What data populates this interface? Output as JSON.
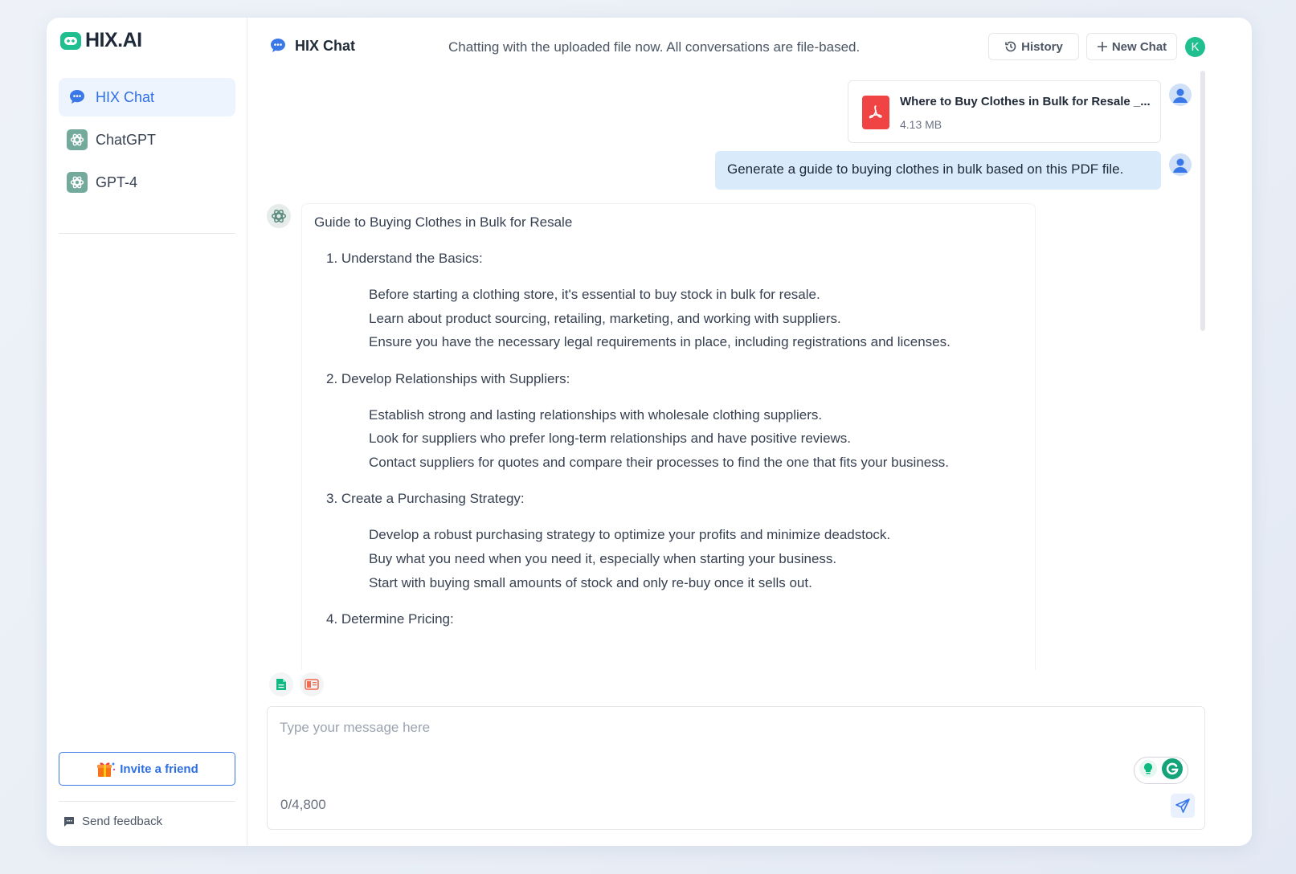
{
  "app": {
    "logo_text": "HIX.AI"
  },
  "sidebar": {
    "items": [
      {
        "label": "HIX Chat",
        "icon": "chat-bubble-icon",
        "active": true
      },
      {
        "label": "ChatGPT",
        "icon": "openai-icon"
      },
      {
        "label": "GPT-4",
        "icon": "openai-icon"
      }
    ],
    "invite_label": "Invite a friend",
    "feedback_label": "Send feedback"
  },
  "header": {
    "title": "HIX Chat",
    "notice": "Chatting with the uploaded file now. All conversations are file-based.",
    "history_label": "History",
    "new_chat_label": "New Chat",
    "user_initial": "K"
  },
  "messages": {
    "file": {
      "name": "Where to Buy Clothes in Bulk for Resale _...",
      "size": "4.13 MB",
      "icon": "pdf-icon"
    },
    "user_message": "Generate a guide to buying clothes in bulk based on this PDF file.",
    "bot": {
      "heading": "Guide to Buying Clothes in Bulk for Resale",
      "sections": [
        {
          "title": "1. Understand the Basics:",
          "bullets": [
            "Before starting a clothing store, it's essential to buy stock in bulk for resale.",
            "Learn about product sourcing, retailing, marketing, and working with suppliers.",
            "Ensure you have the necessary legal requirements in place, including registrations and licenses."
          ]
        },
        {
          "title": "2. Develop Relationships with Suppliers:",
          "bullets": [
            "Establish strong and lasting relationships with wholesale clothing suppliers.",
            "Look for suppliers who prefer long-term relationships and have positive reviews.",
            "Contact suppliers for quotes and compare their processes to find the one that fits your business."
          ]
        },
        {
          "title": "3. Create a Purchasing Strategy:",
          "bullets": [
            "Develop a robust purchasing strategy to optimize your profits and minimize deadstock.",
            "Buy what you need when you need it, especially when starting your business.",
            "Start with buying small amounts of stock and only re-buy once it sells out."
          ]
        },
        {
          "title": "4. Determine Pricing:",
          "bullets": []
        }
      ]
    }
  },
  "composer": {
    "placeholder": "Type your message here",
    "value": "",
    "counter": "0/4,800"
  },
  "colors": {
    "accent": "#2f6fe4",
    "brand_green": "#1fbf8f",
    "user_bubble": "#d9ebfa",
    "pdf_red": "#f04444"
  }
}
